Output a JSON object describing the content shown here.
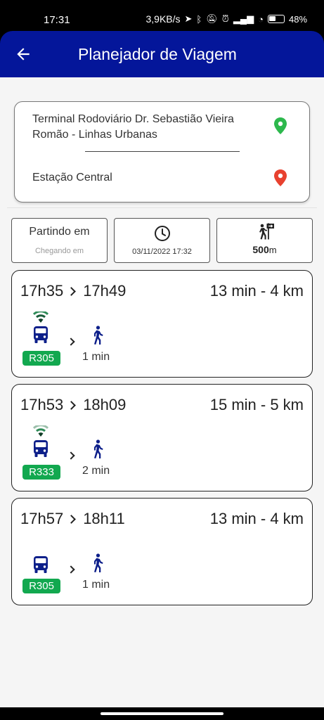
{
  "status_bar": {
    "time": "17:31",
    "net_speed": "3,9KB/s",
    "battery": "48",
    "battery_unit": "%"
  },
  "header": {
    "title": "Planejador de Viagem",
    "back_icon": "arrow-left-icon"
  },
  "route": {
    "origin": "Terminal Rodoviário Dr. Sebastião Vieira Romão - Linhas Urbanas",
    "destination": "Estação Central",
    "origin_pin_color": "#2db84d",
    "destination_pin_color": "#e8412f"
  },
  "options": {
    "depart_label": "Partindo em",
    "arrive_label": "Chegando em",
    "datetime": "03/11/2022 17:32",
    "walk_distance": "500",
    "walk_unit": "m"
  },
  "trips": [
    {
      "depart": "17h35",
      "arrive": "17h49",
      "summary": "13 min - 4 km",
      "line": "R305",
      "walk": "1 min",
      "realtime": true
    },
    {
      "depart": "17h53",
      "arrive": "18h09",
      "summary": "15 min - 5 km",
      "line": "R333",
      "walk": "2 min",
      "realtime": true
    },
    {
      "depart": "17h57",
      "arrive": "18h11",
      "summary": "13 min - 4 km",
      "line": "R305",
      "walk": "1 min",
      "realtime": false
    }
  ],
  "colors": {
    "app_bar": "#04169a",
    "icon_blue": "#0d1f8a",
    "line_badge": "#12a84f"
  }
}
